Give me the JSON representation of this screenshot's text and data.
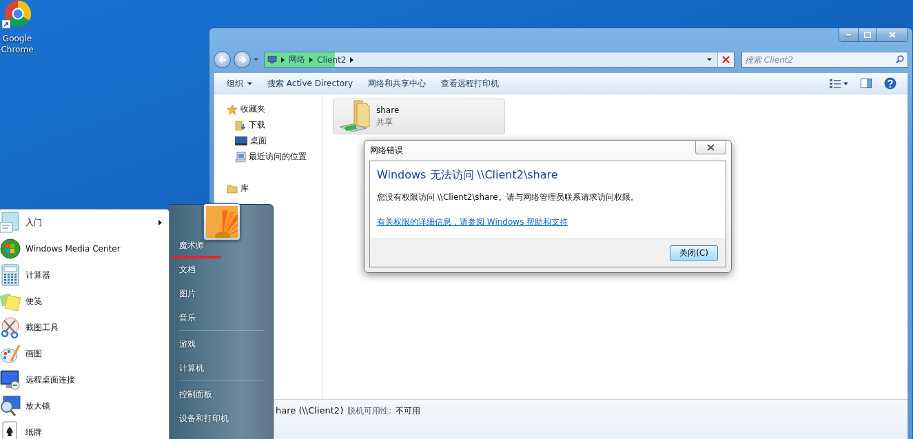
{
  "desktop_icons": [
    {
      "label": "Google Chrome"
    }
  ],
  "explorer": {
    "address": {
      "crumbs": [
        "网络",
        "Client2"
      ],
      "level": 0.15
    },
    "search": {
      "placeholder": "搜索 Client2"
    },
    "toolbar": [
      {
        "label": "组织",
        "kind": "menu"
      },
      {
        "label": "搜索 Active Directory",
        "kind": "command"
      },
      {
        "label": "网络和共享中心",
        "kind": "command"
      },
      {
        "label": "查看远程打印机",
        "kind": "command"
      }
    ],
    "nav": [
      {
        "label": "收藏夹",
        "children": [
          {
            "label": "下载"
          },
          {
            "label": "桌面"
          },
          {
            "label": "最近访问的位置"
          }
        ]
      },
      {
        "label": "库"
      }
    ],
    "items": [
      {
        "name": "share",
        "type": "共享",
        "selected": true
      }
    ],
    "details": {
      "name": "hare (\\\\Client2)",
      "offline_label": "脱机可用性:",
      "offline_value": "不可用"
    }
  },
  "dialog": {
    "title": "网络错误",
    "heading": "Windows 无法访问 \\\\Client2\\share",
    "message": "您没有权限访问 \\\\Client2\\share。请与网络管理员联系请求访问权限。",
    "link": "有关权限的详细信息，请参阅 Windows 帮助和支持",
    "button": "关闭(C)"
  },
  "start_menu": {
    "programs": [
      {
        "label": "入门",
        "submenu": true
      },
      {
        "label": "Windows Media Center",
        "submenu": false
      },
      {
        "label": "计算器",
        "submenu": false
      },
      {
        "label": "便笺",
        "submenu": false
      },
      {
        "label": "截图工具",
        "submenu": false
      },
      {
        "label": "画图",
        "submenu": false
      },
      {
        "label": "远程桌面连接",
        "submenu": false
      },
      {
        "label": "放大镜",
        "submenu": false
      },
      {
        "label": "纸牌",
        "submenu": false
      }
    ],
    "places": [
      {
        "items": [
          {
            "label": "魔术师",
            "annotated": true
          },
          {
            "label": "文档",
            "annotated": false
          },
          {
            "label": "图片",
            "annotated": false
          },
          {
            "label": "音乐",
            "annotated": false
          }
        ]
      },
      {
        "items": [
          {
            "label": "游戏",
            "annotated": false
          },
          {
            "label": "计算机",
            "annotated": false
          }
        ]
      },
      {
        "items": [
          {
            "label": "控制面板",
            "annotated": false
          },
          {
            "label": "设备和打印机",
            "annotated": false
          }
        ]
      }
    ]
  }
}
